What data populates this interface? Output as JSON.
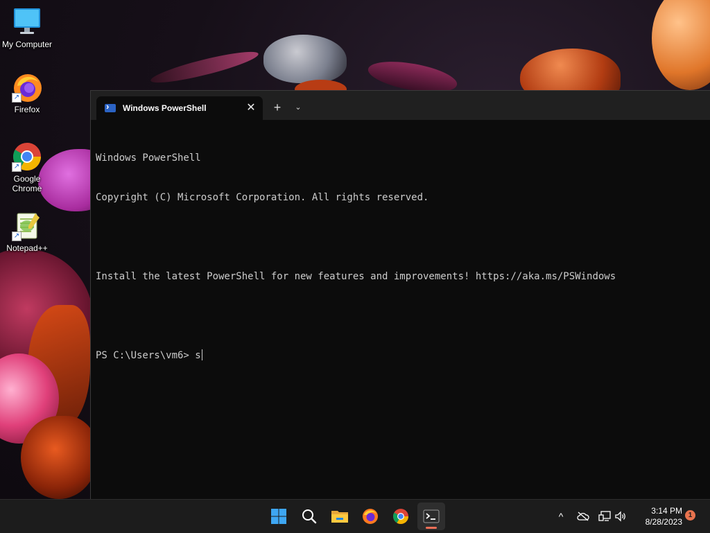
{
  "desktop": {
    "icons": [
      {
        "label": "My Computer",
        "icon": "monitor-icon"
      },
      {
        "label": "Firefox",
        "icon": "firefox-icon"
      },
      {
        "label": "Google Chrome",
        "icon": "chrome-icon"
      },
      {
        "label": "Notepad++",
        "icon": "notepadpp-icon"
      }
    ],
    "shortcut_glyph": "↗"
  },
  "terminal": {
    "tab_title": "Windows PowerShell",
    "close_glyph": "✕",
    "new_tab_glyph": "+",
    "dropdown_glyph": "⌄",
    "lines": [
      "Windows PowerShell",
      "Copyright (C) Microsoft Corporation. All rights reserved.",
      "",
      "Install the latest PowerShell for new features and improvements! https://aka.ms/PSWindows",
      "",
      "PS C:\\Users\\vm6> s"
    ]
  },
  "taskbar": {
    "apps": [
      {
        "name": "start",
        "icon": "windows-logo-icon"
      },
      {
        "name": "search",
        "icon": "search-icon"
      },
      {
        "name": "file-explorer",
        "icon": "folder-icon"
      },
      {
        "name": "firefox",
        "icon": "firefox-icon"
      },
      {
        "name": "chrome",
        "icon": "chrome-icon"
      },
      {
        "name": "terminal",
        "icon": "terminal-icon",
        "active": true
      }
    ],
    "tray": {
      "chevron_glyph": "^",
      "time": "3:14 PM",
      "date": "8/28/2023",
      "notification_count": "1"
    }
  },
  "colors": {
    "accent_indicator": "#f27058",
    "terminal_bg": "#0c0c0c",
    "terminal_fg": "#cccccc"
  }
}
